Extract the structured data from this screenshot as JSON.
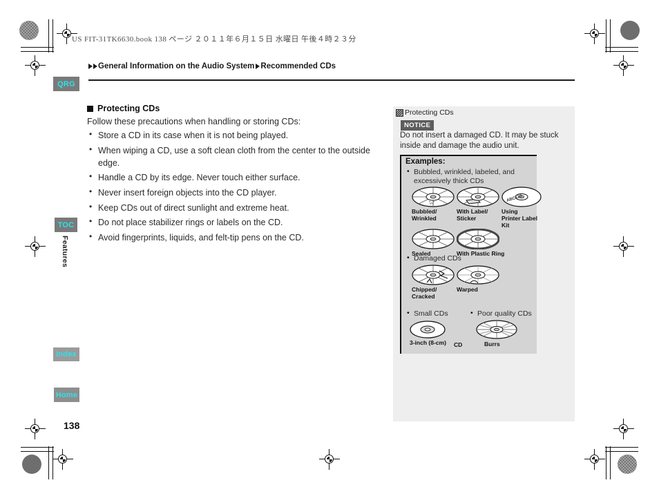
{
  "print_header": {
    "book_line": "US FIT-31TK6630.book   138 ページ   ２０１１年６月１５日   水曜日   午後４時２３分"
  },
  "breadcrumb": {
    "items": [
      "General Information on the Audio System",
      "Recommended CDs"
    ]
  },
  "sidebar": {
    "tabs": [
      {
        "label": "QRG"
      },
      {
        "label": "TOC"
      },
      {
        "label": "Index"
      },
      {
        "label": "Home"
      }
    ],
    "vertical_label": "Features"
  },
  "main": {
    "heading": "Protecting CDs",
    "lead": "Follow these precautions when handling or storing CDs:",
    "bullets": [
      "Store a CD in its case when it is not being played.",
      "When wiping a CD, use a soft clean cloth from the center to the outside edge.",
      "Handle a CD by its edge. Never touch either surface.",
      "Never insert foreign objects into the CD player.",
      "Keep CDs out of direct sunlight and extreme heat.",
      "Do not place stabilizer rings or labels on the CD.",
      "Avoid fingerprints, liquids, and felt-tip pens on the CD."
    ]
  },
  "page_number": "138",
  "side_panel": {
    "title": "Protecting CDs",
    "notice_badge": "NOTICE",
    "notice_text": "Do not insert a damaged CD. It may be stuck inside and damage the audio unit.",
    "examples_title": "Examples:",
    "groups": [
      {
        "label": "Bubbled, wrinkled, labeled, and excessively thick CDs",
        "items": [
          {
            "caption": "Bubbled/\nWrinkled"
          },
          {
            "caption": "With Label/\nSticker"
          },
          {
            "caption": "Using\nPrinter Label\nKit"
          },
          {
            "caption": "Sealed"
          },
          {
            "caption": "With Plastic Ring"
          }
        ]
      },
      {
        "label": "Damaged CDs",
        "items": [
          {
            "caption": "Chipped/\nCracked"
          },
          {
            "caption": "Warped"
          }
        ]
      },
      {
        "label": "Small CDs",
        "items": [
          {
            "caption": "3-inch (8-cm)"
          }
        ],
        "extra_label": "CD"
      },
      {
        "label": "Poor quality CDs",
        "items": [
          {
            "caption": "Burrs"
          }
        ]
      }
    ]
  },
  "colors": {
    "tab_bg": "#7a7a7a",
    "tab_text": "#2ce2ea",
    "panel_bg": "#eeeeee",
    "examples_bg": "#d4d4d4",
    "notice_bg": "#5d5d5d"
  }
}
